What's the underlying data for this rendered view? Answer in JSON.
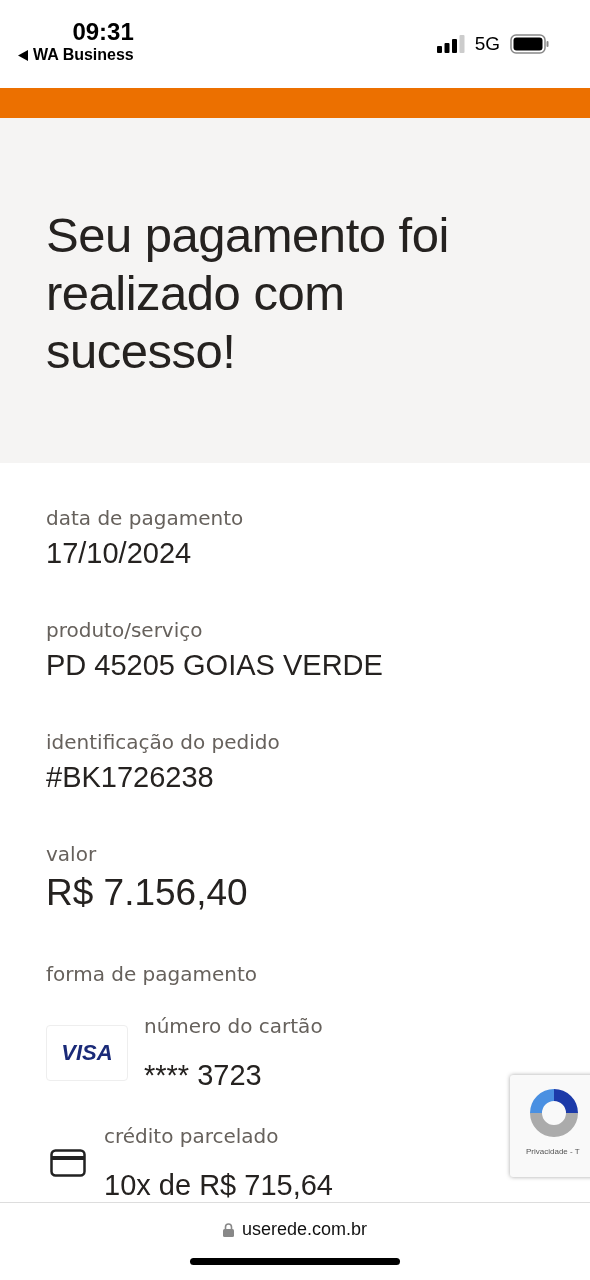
{
  "status_bar": {
    "time": "09:31",
    "back_label": "WA Business",
    "network": "5G"
  },
  "hero": {
    "title": "Seu pagamento foi realizado com sucesso!"
  },
  "details": [
    {
      "label": "data de pagamento",
      "value": "17/10/2024",
      "kind": "plain"
    },
    {
      "label": "produto/serviço",
      "value": "PD 45205 GOIAS VERDE",
      "kind": "plain"
    },
    {
      "label": "identificação do pedido",
      "value": "#BK1726238",
      "kind": "plain"
    },
    {
      "label": "valor",
      "value": "R$ 7.156,40",
      "kind": "amount"
    }
  ],
  "payment": {
    "label": "forma de pagamento",
    "methods": [
      {
        "kind": "card",
        "brand": "VISA",
        "label": "número do cartão",
        "value": "**** 3723"
      },
      {
        "kind": "installment",
        "label": "crédito parcelado",
        "value": "10x de R$ 715,64"
      }
    ]
  },
  "recaptcha": {
    "text": "Privacidade - T"
  },
  "browser_bar": {
    "url": "userede.com.br"
  }
}
